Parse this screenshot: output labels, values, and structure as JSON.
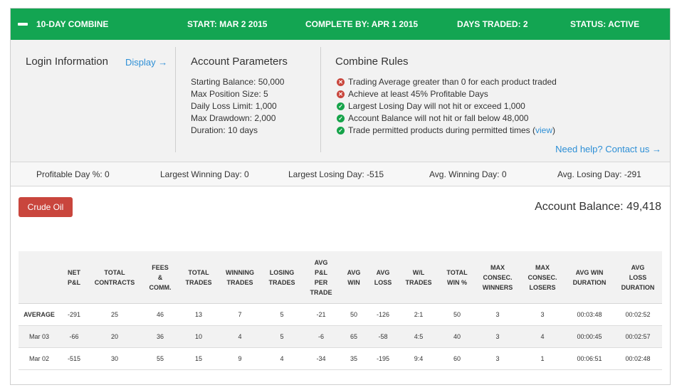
{
  "header": {
    "title": "10-DAY COMBINE",
    "start": "START: MAR 2 2015",
    "complete_by": "COMPLETE BY: APR 1 2015",
    "days_traded": "DAYS TRADED: 2",
    "status": "STATUS: ACTIVE",
    "bar_color": "#13a552"
  },
  "login": {
    "heading": "Login Information",
    "display_link": "Display →"
  },
  "account_parameters": {
    "heading": "Account Parameters",
    "items": [
      "Starting Balance: 50,000",
      "Max Position Size: 5",
      "Daily Loss Limit: 1,000",
      "Max Drawdown: 2,000",
      "Duration: 10 days"
    ]
  },
  "combine_rules": {
    "heading": "Combine Rules",
    "items": [
      {
        "text": "Trading Average greater than 0 for each product traded",
        "status": "fail"
      },
      {
        "text": "Achieve at least 45% Profitable Days",
        "status": "fail"
      },
      {
        "text": "Largest Losing Day will not hit or exceed 1,000",
        "status": "pass"
      },
      {
        "text": "Account Balance will not hit or fall below 48,000",
        "status": "pass"
      },
      {
        "text": "Trade permitted products during permitted times (",
        "status": "pass",
        "link": "view",
        "suffix": ")"
      }
    ],
    "help_link": "Need help? Contact us →",
    "colors": {
      "pass": "#16a34a",
      "fail": "#c9463d",
      "link": "#2d8fd6"
    }
  },
  "summary": {
    "profitable_day": "Profitable Day %: 0",
    "largest_winning_day": "Largest Winning Day: 0",
    "largest_losing_day": "Largest Losing Day: -515",
    "avg_winning_day": "Avg. Winning Day: 0",
    "avg_losing_day": "Avg. Losing Day: -291"
  },
  "product_button": "Crude Oil",
  "account_balance": "Account Balance: 49,418",
  "table": {
    "columns": [
      [
        "NET",
        "P&L"
      ],
      [
        "TOTAL",
        "CONTRACTS"
      ],
      [
        "FEES",
        "&",
        "COMM."
      ],
      [
        "TOTAL",
        "TRADES"
      ],
      [
        "WINNING",
        "TRADES"
      ],
      [
        "LOSING",
        "TRADES"
      ],
      [
        "AVG",
        "P&L",
        "PER",
        "TRADE"
      ],
      [
        "AVG",
        "WIN"
      ],
      [
        "AVG",
        "LOSS"
      ],
      [
        "W/L",
        "TRADES"
      ],
      [
        "TOTAL",
        "WIN %"
      ],
      [
        "MAX",
        "CONSEC.",
        "WINNERS"
      ],
      [
        "MAX",
        "CONSEC.",
        "LOSERS"
      ],
      [
        "AVG WIN",
        "DURATION"
      ],
      [
        "AVG",
        "LOSS",
        "DURATION"
      ]
    ],
    "rows": [
      {
        "label": "AVERAGE",
        "kind": "avg",
        "values": [
          "-291",
          "25",
          "46",
          "13",
          "7",
          "5",
          "-21",
          "50",
          "-126",
          "2:1",
          "50",
          "3",
          "3",
          "00:03:48",
          "00:02:52"
        ]
      },
      {
        "label": "Mar 03",
        "kind": "alt",
        "values": [
          "-66",
          "20",
          "36",
          "10",
          "4",
          "5",
          "-6",
          "65",
          "-58",
          "4:5",
          "40",
          "3",
          "4",
          "00:00:45",
          "00:02:57"
        ]
      },
      {
        "label": "Mar 02",
        "kind": "plain",
        "values": [
          "-515",
          "30",
          "55",
          "15",
          "9",
          "4",
          "-34",
          "35",
          "-195",
          "9:4",
          "60",
          "3",
          "1",
          "00:06:51",
          "00:02:48"
        ]
      }
    ]
  }
}
